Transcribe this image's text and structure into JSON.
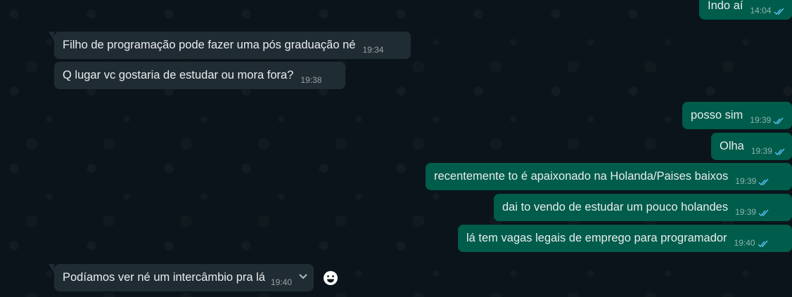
{
  "messages": [
    {
      "direction": "out",
      "text": "Indo aí",
      "time": "14:04",
      "read": true
    },
    {
      "direction": "in",
      "text": "Filho de programação pode fazer uma pós graduação né",
      "time": "19:34"
    },
    {
      "direction": "in",
      "text": "Q lugar vc gostaria de estudar ou mora fora?",
      "time": "19:38"
    },
    {
      "direction": "out",
      "text": "posso sim",
      "time": "19:39",
      "read": true
    },
    {
      "direction": "out",
      "text": "Olha",
      "time": "19:39",
      "read": true
    },
    {
      "direction": "out",
      "text": "recentemente to é apaixonado na Holanda/Paises baixos",
      "time": "19:39",
      "read": true
    },
    {
      "direction": "out",
      "text": "dai to vendo de estudar um pouco holandes",
      "time": "19:39",
      "read": true
    },
    {
      "direction": "out",
      "text": "lá tem vagas legais de emprego para programador",
      "time": "19:40",
      "read": true
    },
    {
      "direction": "in",
      "text": "Podíamos ver né um intercâmbio pra lá",
      "time": "19:40"
    }
  ],
  "colors": {
    "background": "#0b141a",
    "incoming_bubble": "#202c33",
    "outgoing_bubble": "#005c4b",
    "text": "#e9edef",
    "read_check": "#53bdeb"
  },
  "icons": {
    "read_check": "double-check-icon",
    "message_menu": "chevron-down-icon",
    "react": "emoji-icon"
  }
}
